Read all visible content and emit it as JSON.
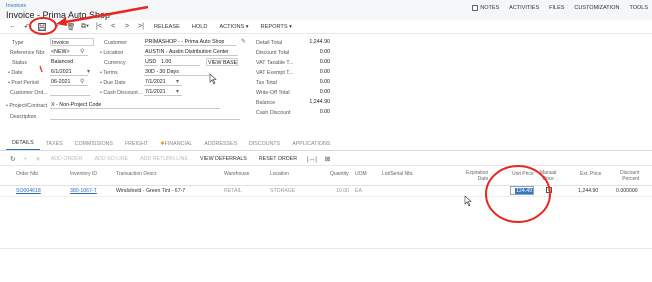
{
  "header": {
    "breadcrumb": "Invoices",
    "title": "Invoice - Prima Auto Shop",
    "top_links": [
      "NOTES",
      "ACTIVITIES",
      "FILES",
      "CUSTOMIZATION",
      "TOOLS"
    ]
  },
  "toolbar": {
    "release": "RELEASE",
    "hold": "HOLD",
    "actions": "ACTIONS",
    "reports": "REPORTS"
  },
  "form": {
    "type_label": "Type",
    "type_value": "Invoice",
    "refnbr_label": "Reference Nbr.",
    "refnbr_value": "<NEW>",
    "status_label": "Status",
    "status_value": "Balanced",
    "date_label": "Date",
    "date_value": "6/1/2021",
    "postperiod_label": "Post Period",
    "postperiod_value": "06-2021",
    "customerord_label": "Customer Ord...",
    "customerord_value": "",
    "project_label": "Project/Contract",
    "project_value": "X - Non-Project Code",
    "description_label": "Description",
    "description_value": "",
    "customer_label": "Customer",
    "customer_value": "PRIMASHOP - - Prima Auto Shop",
    "location_label": "Location",
    "location_value": "AUSTIN - Austin Distribution Center",
    "currency_label": "Currency",
    "currency_value": "USD",
    "currency_rate": "1.00",
    "view_base": "VIEW BASE",
    "terms_label": "Terms",
    "terms_value": "30D - 30 Days",
    "duedate_label": "Due Date",
    "duedate_value": "7/1/2021",
    "cashdiscount_label": "Cash Discount...",
    "cashdiscount_value": "7/1/2021"
  },
  "totals": {
    "detail_total_label": "Detail Total",
    "detail_total_value": "1,244.90",
    "discount_total_label": "Discount Total",
    "discount_total_value": "0.00",
    "vat_taxable_label": "VAT Taxable T...",
    "vat_taxable_value": "0.00",
    "vat_exempt_label": "VAT Exempt T...",
    "vat_exempt_value": "0.00",
    "tax_total_label": "Tax Total",
    "tax_total_value": "0.00",
    "writeoff_label": "Write-Off Total",
    "writeoff_value": "0.00",
    "balance_label": "Balance",
    "balance_value": "1,244.90",
    "cash_discount_label": "Cash Discount",
    "cash_discount_value": "0.00"
  },
  "tabs": [
    "DETAILS",
    "TAXES",
    "COMMISSIONS",
    "FREIGHT",
    "FINANCIAL",
    "ADDRESSES",
    "DISCOUNTS",
    "APPLICATIONS"
  ],
  "grid_toolbar": {
    "add_order": "ADD ORDER",
    "add_so_line": "ADD SO LINE",
    "add_return_line": "ADD RETURN LINE",
    "view_deferrals": "VIEW DEFERRALS",
    "reset_order": "RESET ORDER"
  },
  "grid": {
    "headers": {
      "order_nbr": "Order Nbr.",
      "inventory_id": "Inventory ID",
      "transaction_descr": "Transaction Descr.",
      "warehouse": "Warehouse",
      "location": "Location",
      "quantity": "Quantity",
      "uom": "UOM",
      "lot_serial": "Lot/Serial Nbr.",
      "expiration_date_1": "Expiration",
      "expiration_date_2": "Date",
      "unit_price": "Unit Price",
      "manual_price_1": "Manual",
      "manual_price_2": "Price",
      "ext_price": "Ext. Price",
      "discount_percent_1": "Discount",
      "discount_percent_2": "Percent"
    },
    "rows": [
      {
        "order_nbr": "SO004618",
        "inventory_id": "380-1067-T",
        "transaction_descr": "Windshield - Green Tint - 67-7",
        "warehouse": "RETAIL",
        "location": "STORAGE",
        "quantity": "10.00",
        "uom": "EA",
        "unit_price": "124.49",
        "ext_price": "1,244.90",
        "discount_percent": "0.000000"
      }
    ]
  },
  "colors": {
    "link": "#2a6ebb",
    "annotation": "#e8281f",
    "selection": "#3a76c4"
  }
}
